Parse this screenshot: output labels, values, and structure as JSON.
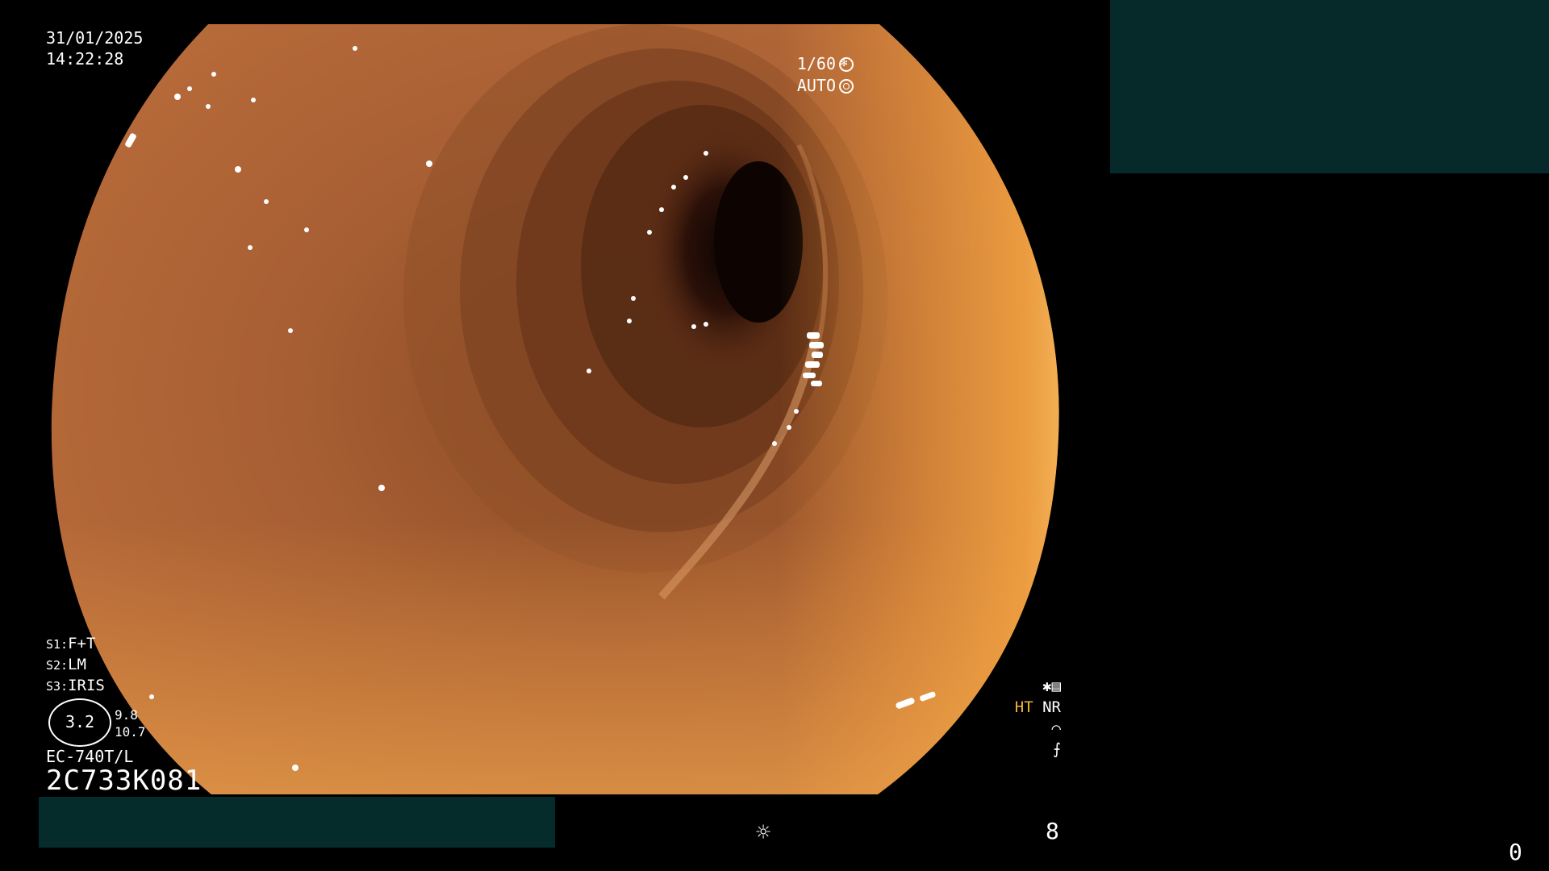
{
  "overlay": {
    "date": "31/01/2025",
    "time": "14:22:28",
    "shutter_speed": "1/60",
    "exposure_mode": "AUTO",
    "settings": [
      {
        "key": "S1:",
        "value": "F+T"
      },
      {
        "key": "S2:",
        "value": "LM"
      },
      {
        "key": "S3:",
        "value": "IRIS"
      }
    ],
    "gauge_value": "3.2",
    "gauge_side_top": "9.8",
    "gauge_side_bottom": "10.7",
    "scope_model": "EC-740T/L",
    "serial_number": "2C733K081",
    "mode_ht": "HT",
    "mode_nr": "NR",
    "bottom_counter": "8",
    "corner_counter": "0"
  },
  "icons": {
    "shutter": "shutter-icon",
    "auto": "auto-exposure-icon",
    "enhance": "enhancement-icon",
    "brightness": "brightness-icon"
  },
  "colors": {
    "tissue": "#b5673a",
    "lumen_dark": "#1a0804",
    "highlight": "#f7a03a",
    "ht_label": "#f2b43a",
    "panel": "#062b2b"
  }
}
